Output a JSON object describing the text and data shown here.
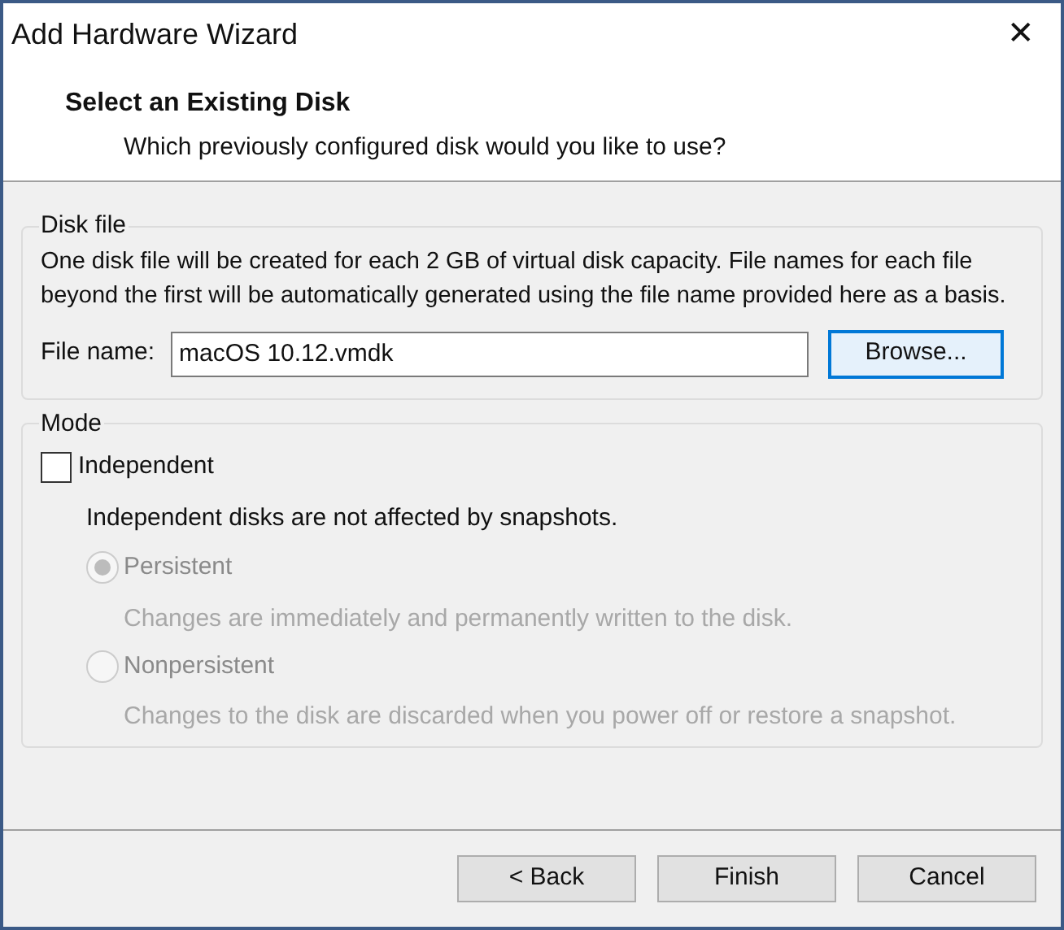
{
  "window": {
    "title": "Add Hardware Wizard",
    "close": "✕"
  },
  "header": {
    "title": "Select an Existing Disk",
    "subtitle": "Which previously configured disk would you like to use?"
  },
  "disk_file": {
    "legend": "Disk file",
    "description": "One disk file will be created for each 2 GB of virtual disk capacity. File names for each file beyond the first will be automatically generated using the file name provided here as a basis.",
    "label": "File name:",
    "value": "macOS 10.12.vmdk",
    "browse": "Browse..."
  },
  "mode": {
    "legend": "Mode",
    "independent": {
      "label": "Independent",
      "checked": false
    },
    "note": "Independent disks are not affected by snapshots.",
    "options": [
      {
        "label": "Persistent",
        "selected": true,
        "disabled": true,
        "description": "Changes are immediately and permanently written to the disk."
      },
      {
        "label": "Nonpersistent",
        "selected": false,
        "disabled": true,
        "description": "Changes to the disk are discarded when you power off or restore a snapshot."
      }
    ]
  },
  "buttons": [
    {
      "label": "< Back",
      "default": false
    },
    {
      "label": "Finish",
      "default": false
    },
    {
      "label": "Cancel",
      "default": false
    }
  ]
}
